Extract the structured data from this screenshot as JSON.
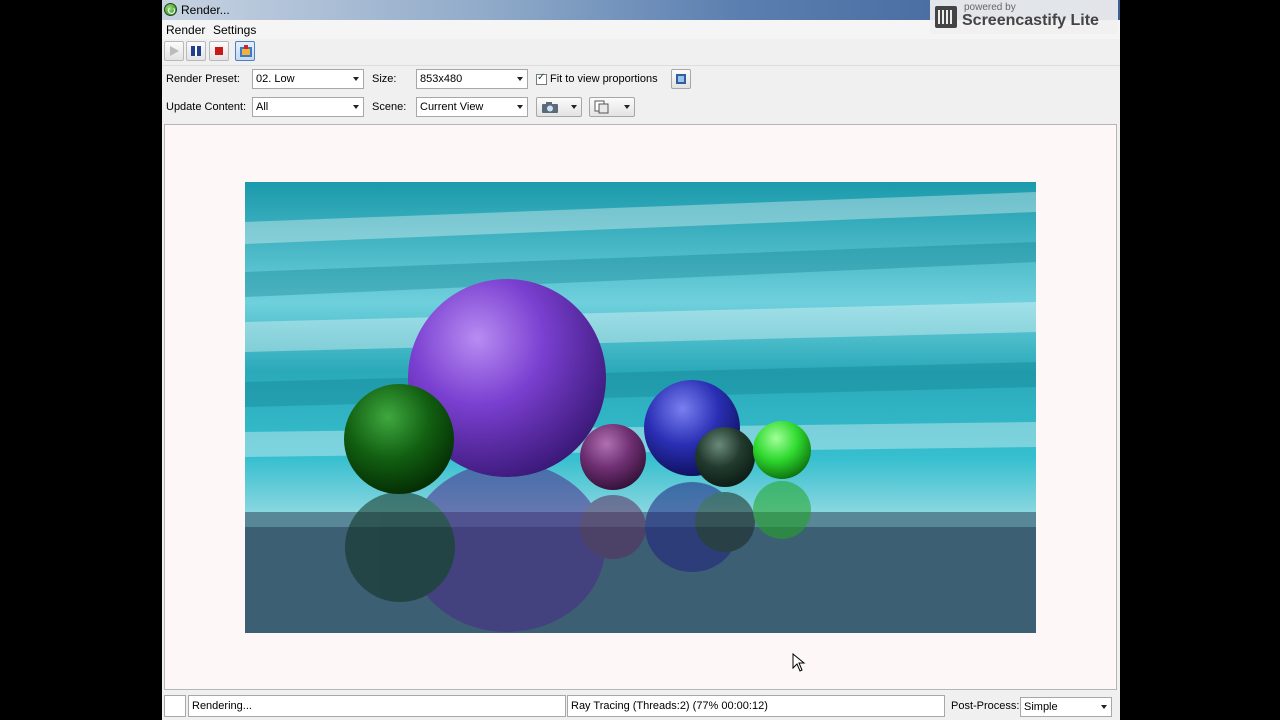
{
  "window": {
    "title": "Render..."
  },
  "menu": {
    "items": [
      "Render",
      "Settings"
    ]
  },
  "toolbar": {
    "buttons": [
      "play-icon",
      "pause-icon",
      "stop-icon",
      "save-image-icon"
    ]
  },
  "options": {
    "render_preset_label": "Render Preset:",
    "render_preset_value": "02. Low",
    "size_label": "Size:",
    "size_value": "853x480",
    "fit_label": "Fit to view proportions",
    "fit_checked": true,
    "update_content_label": "Update Content:",
    "update_content_value": "All",
    "scene_label": "Scene:",
    "scene_value": "Current View"
  },
  "status": {
    "left": "Rendering...",
    "progress": "Ray Tracing (Threads:2) (77% 00:00:12)",
    "postprocess_label": "Post-Process:",
    "postprocess_value": "Simple"
  },
  "watermark": {
    "powered": "powered by",
    "brand": "Screencastify Lite"
  },
  "colors": {
    "sky": "#2fb3c4",
    "floor": "#3d5f73",
    "purple_sphere": "#7a3fd0",
    "green_sphere": "#1e7a1e",
    "blue_sphere": "#2a2fb5",
    "lime_sphere": "#2fd92f"
  }
}
